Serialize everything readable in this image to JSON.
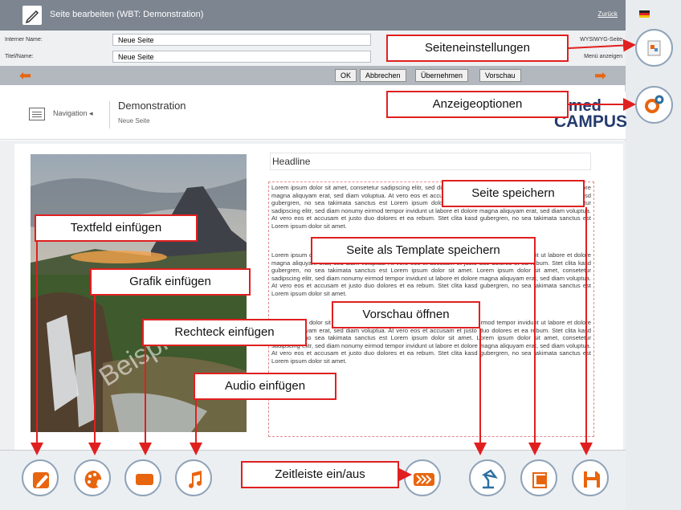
{
  "window": {
    "title": "Seite bearbeiten (WBT: Demonstration)",
    "back_link": "Zurück"
  },
  "fields": {
    "internal_name_label": "Interner Name:",
    "internal_name_value": "Neue Seite",
    "title_label": "Titel/Name:",
    "title_value": "Neue Seite",
    "wysiwyg_label": "WYSIWYG-Seite",
    "menu_label": "Menü anzeigen"
  },
  "nav_buttons": {
    "ok": "OK",
    "cancel": "Abbrechen",
    "apply": "Übernehmen",
    "preview": "Vorschau"
  },
  "page_header": {
    "nav_label": "Navigation",
    "title": "Demonstration",
    "subtitle": "Neue Seite",
    "logo_line1": "iomed",
    "logo_line2": "CAMPUS"
  },
  "content": {
    "headline": "Headline",
    "watermark": "Beispiel",
    "paragraphs": [
      "Lorem ipsum dolor sit amet, consetetur sadipscing elitr, sed diam nonumy eirmod tempor invidunt ut labore et dolore magna aliquyam erat, sed diam voluptua. At vero eos et accusam et justo duo dolores et ea rebum. Stet clita kasd gubergren, no sea takimata sanctus est Lorem ipsum dolor sit amet. Lorem ipsum dolor sit amet, consetetur sadipscing elitr, sed diam nonumy eirmod tempor invidunt ut labore et dolore magna aliquyam erat, sed diam voluptua. At vero eos et accusam et justo duo dolores et ea rebum. Stet clita kasd gubergren, no sea takimata sanctus est Lorem ipsum dolor sit amet.",
      "Lorem ipsum dolor sit amet, consetetur sadipscing elitr, sed diam nonumy eirmod tempor invidunt ut labore et dolore magna aliquyam erat, sed diam voluptua. At vero eos et accusam et justo duo dolores et ea rebum. Stet clita kasd gubergren, no sea takimata sanctus est Lorem ipsum dolor sit amet. Lorem ipsum dolor sit amet, consetetur sadipscing elitr, sed diam nonumy eirmod tempor invidunt ut labore et dolore magna aliquyam erat, sed diam voluptua. At vero eos et accusam et justo duo dolores et ea rebum. Stet clita kasd gubergren, no sea takimata sanctus est Lorem ipsum dolor sit amet.",
      "Lorem ipsum dolor sit amet, consetetur sadipscing elitr, sed diam nonumy eirmod tempor invidunt ut labore et dolore magna aliquyam erat, sed diam voluptua. At vero eos et accusam et justo duo dolores et ea rebum. Stet clita kasd gubergren, no sea takimata sanctus est Lorem ipsum dolor sit amet. Lorem ipsum dolor sit amet, consetetur sadipscing elitr, sed diam nonumy eirmod tempor invidunt ut labore et dolore magna aliquyam erat, sed diam voluptua. At vero eos et accusam et justo duo dolores et ea rebum. Stet clita kasd gubergren, no sea takimata sanctus est Lorem ipsum dolor sit amet."
    ]
  },
  "callouts": {
    "page_settings": "Seiteneinstellungen",
    "display_options": "Anzeigeoptionen",
    "save_page": "Seite speichern",
    "insert_textfield": "Textfeld einfügen",
    "save_as_template": "Seite als Template speichern",
    "insert_graphic": "Grafik einfügen",
    "open_preview": "Vorschau öffnen",
    "insert_rectangle": "Rechteck einfügen",
    "insert_audio": "Audio einfügen",
    "timeline_toggle": "Zeitleiste ein/aus"
  },
  "colors": {
    "accent_orange": "#e8650f",
    "callout_red": "#e02020",
    "button_ring": "#8fa3b8",
    "titlebar": "#7d8590"
  },
  "icons": {
    "toolbar": [
      "pencil-icon",
      "paint-icon",
      "rectangle-icon",
      "music-note-icon",
      "chevrons-right-icon",
      "desk-lamp-icon",
      "template-icon",
      "floppy-disk-icon"
    ],
    "side": [
      "page-settings-icon",
      "gears-icon"
    ]
  }
}
